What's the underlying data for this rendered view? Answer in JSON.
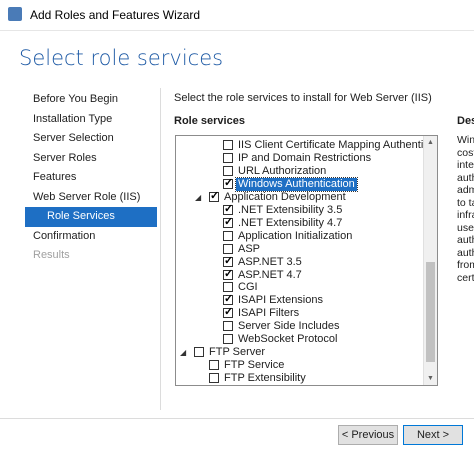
{
  "window": {
    "title": "Add Roles and Features Wizard"
  },
  "header": {
    "title": "Select role services"
  },
  "nav": [
    {
      "label": "Before You Begin",
      "state": "normal"
    },
    {
      "label": "Installation Type",
      "state": "normal"
    },
    {
      "label": "Server Selection",
      "state": "normal"
    },
    {
      "label": "Server Roles",
      "state": "normal"
    },
    {
      "label": "Features",
      "state": "normal"
    },
    {
      "label": "Web Server Role (IIS)",
      "state": "normal"
    },
    {
      "label": "Role Services",
      "state": "selected"
    },
    {
      "label": "Confirmation",
      "state": "normal"
    },
    {
      "label": "Results",
      "state": "disabled"
    }
  ],
  "main": {
    "instruction": "Select the role services to install for Web Server (IIS)",
    "role_services_header": "Role services",
    "description_header": "Desc",
    "description_lines": [
      "Wind",
      "cost",
      "inte",
      "auth",
      "adm",
      "to ta",
      "infra",
      "user",
      "auth",
      "auth",
      "from",
      "cert"
    ]
  },
  "tree": [
    {
      "label": "IIS Client Certificate Mapping Authentication",
      "checked": false,
      "level": 3
    },
    {
      "label": "IP and Domain Restrictions",
      "checked": false,
      "level": 3
    },
    {
      "label": "URL Authorization",
      "checked": false,
      "level": 3
    },
    {
      "label": "Windows Authentication",
      "checked": true,
      "level": 3,
      "selected": true
    },
    {
      "label": "Application Development",
      "checked": true,
      "level": 2,
      "expanded": true
    },
    {
      "label": ".NET Extensibility 3.5",
      "checked": true,
      "level": 3
    },
    {
      "label": ".NET Extensibility 4.7",
      "checked": true,
      "level": 3
    },
    {
      "label": "Application Initialization",
      "checked": false,
      "level": 3
    },
    {
      "label": "ASP",
      "checked": false,
      "level": 3
    },
    {
      "label": "ASP.NET 3.5",
      "checked": true,
      "level": 3
    },
    {
      "label": "ASP.NET 4.7",
      "checked": true,
      "level": 3
    },
    {
      "label": "CGI",
      "checked": false,
      "level": 3
    },
    {
      "label": "ISAPI Extensions",
      "checked": true,
      "level": 3
    },
    {
      "label": "ISAPI Filters",
      "checked": true,
      "level": 3
    },
    {
      "label": "Server Side Includes",
      "checked": false,
      "level": 3
    },
    {
      "label": "WebSocket Protocol",
      "checked": false,
      "level": 3
    },
    {
      "label": "FTP Server",
      "checked": false,
      "level": 1,
      "expanded": true
    },
    {
      "label": "FTP Service",
      "checked": false,
      "level": 2
    },
    {
      "label": "FTP Extensibility",
      "checked": false,
      "level": 2
    }
  ],
  "buttons": {
    "previous": "< Previous",
    "next": "Next >"
  },
  "icons": {
    "expanded": "◢",
    "scroll_up": "▲",
    "scroll_down": "▼"
  },
  "colors": {
    "accent": "#1e6fc4",
    "title": "#1e5aa5"
  }
}
